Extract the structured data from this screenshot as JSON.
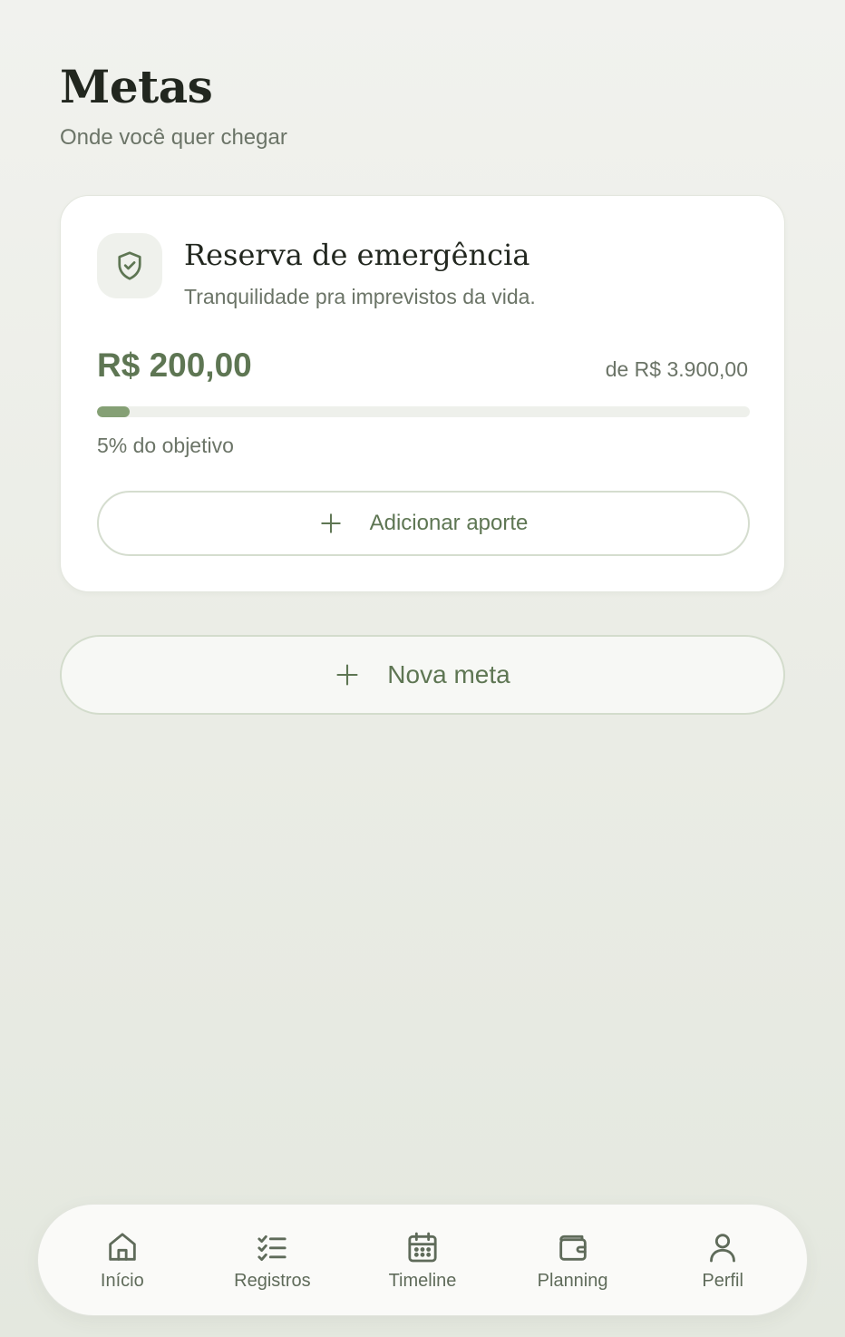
{
  "header": {
    "title": "Metas",
    "subtitle": "Onde você quer chegar"
  },
  "goals": [
    {
      "icon": "shield-check-icon",
      "title": "Reserva de emergência",
      "description": "Tranquilidade pra imprevistos da vida.",
      "amount": "R$ 200,00",
      "target": "de R$ 3.900,00",
      "progress_fraction": 0.05,
      "progress_label": "5% do objetivo",
      "add_button_label": "Adicionar aporte"
    }
  ],
  "new_goal_button": {
    "label": "Nova meta"
  },
  "bottom_nav": {
    "items": [
      {
        "label": "Início",
        "icon": "home-icon"
      },
      {
        "label": "Registros",
        "icon": "checklist-icon"
      },
      {
        "label": "Timeline",
        "icon": "calendar-icon"
      },
      {
        "label": "Planning",
        "icon": "wallet-icon"
      },
      {
        "label": "Perfil",
        "icon": "user-icon"
      }
    ]
  },
  "colors": {
    "accent": "#5e7653",
    "progress_fill": "#85a075",
    "background": "#eceee8"
  }
}
